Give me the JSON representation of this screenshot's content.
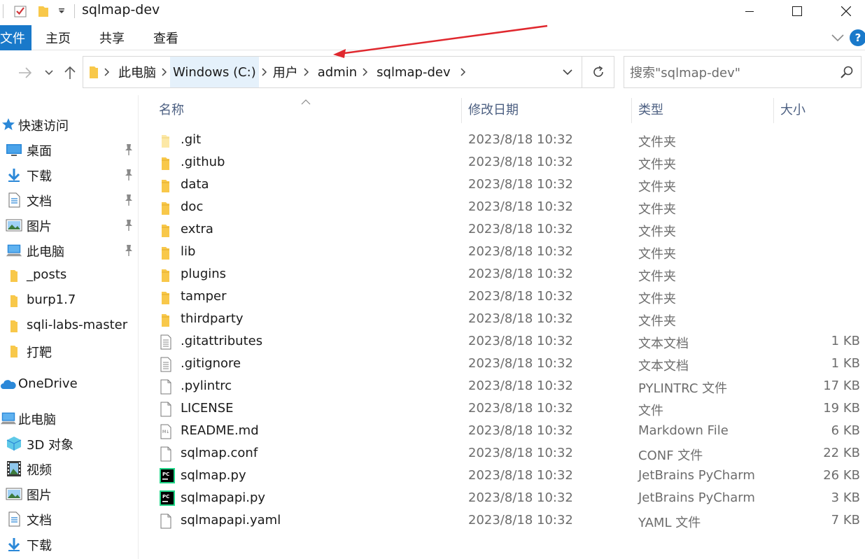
{
  "window": {
    "title": "sqlmap-dev"
  },
  "ribbon": {
    "tabs": [
      "文件",
      "主页",
      "共享",
      "查看"
    ]
  },
  "address": {
    "crumbs": [
      "此电脑",
      "Windows (C:)",
      "用户",
      "admin",
      "sqlmap-dev"
    ]
  },
  "search": {
    "placeholder": "搜索\"sqlmap-dev\""
  },
  "sidebar": {
    "quick_access": "快速访问",
    "items": [
      {
        "label": "桌面",
        "icon": "desktop-icon",
        "pinned": true
      },
      {
        "label": "下载",
        "icon": "download-icon",
        "pinned": true
      },
      {
        "label": "文档",
        "icon": "document-icon",
        "pinned": true
      },
      {
        "label": "图片",
        "icon": "picture-icon",
        "pinned": true
      },
      {
        "label": "此电脑",
        "icon": "computer-icon",
        "pinned": true
      },
      {
        "label": "_posts",
        "icon": "folder-icon",
        "pinned": false
      },
      {
        "label": "burp1.7",
        "icon": "folder-icon",
        "pinned": false
      },
      {
        "label": "sqli-labs-master",
        "icon": "folder-icon",
        "pinned": false
      },
      {
        "label": "打靶",
        "icon": "folder-icon",
        "pinned": false
      }
    ],
    "onedrive": "OneDrive",
    "this_pc": "此电脑",
    "pc_items": [
      {
        "label": "3D 对象",
        "icon": "3d-objects-icon"
      },
      {
        "label": "视频",
        "icon": "video-icon"
      },
      {
        "label": "图片",
        "icon": "picture-icon"
      },
      {
        "label": "文档",
        "icon": "document-icon"
      },
      {
        "label": "下载",
        "icon": "download-icon"
      }
    ]
  },
  "columns": {
    "name": "名称",
    "date": "修改日期",
    "type": "类型",
    "size": "大小"
  },
  "files": [
    {
      "name": ".git",
      "date": "2023/8/18 10:32",
      "type": "文件夹",
      "size": "",
      "icon": "folder-light-icon"
    },
    {
      "name": ".github",
      "date": "2023/8/18 10:32",
      "type": "文件夹",
      "size": "",
      "icon": "folder-icon"
    },
    {
      "name": "data",
      "date": "2023/8/18 10:32",
      "type": "文件夹",
      "size": "",
      "icon": "folder-icon"
    },
    {
      "name": "doc",
      "date": "2023/8/18 10:32",
      "type": "文件夹",
      "size": "",
      "icon": "folder-icon"
    },
    {
      "name": "extra",
      "date": "2023/8/18 10:32",
      "type": "文件夹",
      "size": "",
      "icon": "folder-icon"
    },
    {
      "name": "lib",
      "date": "2023/8/18 10:32",
      "type": "文件夹",
      "size": "",
      "icon": "folder-icon"
    },
    {
      "name": "plugins",
      "date": "2023/8/18 10:32",
      "type": "文件夹",
      "size": "",
      "icon": "folder-icon"
    },
    {
      "name": "tamper",
      "date": "2023/8/18 10:32",
      "type": "文件夹",
      "size": "",
      "icon": "folder-icon"
    },
    {
      "name": "thirdparty",
      "date": "2023/8/18 10:32",
      "type": "文件夹",
      "size": "",
      "icon": "folder-icon"
    },
    {
      "name": ".gitattributes",
      "date": "2023/8/18 10:32",
      "type": "文本文档",
      "size": "1 KB",
      "icon": "text-file-icon"
    },
    {
      "name": ".gitignore",
      "date": "2023/8/18 10:32",
      "type": "文本文档",
      "size": "1 KB",
      "icon": "text-file-icon"
    },
    {
      "name": ".pylintrc",
      "date": "2023/8/18 10:32",
      "type": "PYLINTRC 文件",
      "size": "17 KB",
      "icon": "blank-file-icon"
    },
    {
      "name": "LICENSE",
      "date": "2023/8/18 10:32",
      "type": "文件",
      "size": "19 KB",
      "icon": "blank-file-icon"
    },
    {
      "name": "README.md",
      "date": "2023/8/18 10:32",
      "type": "Markdown File",
      "size": "6 KB",
      "icon": "markdown-file-icon"
    },
    {
      "name": "sqlmap.conf",
      "date": "2023/8/18 10:32",
      "type": "CONF 文件",
      "size": "22 KB",
      "icon": "blank-file-icon"
    },
    {
      "name": "sqlmap.py",
      "date": "2023/8/18 10:32",
      "type": "JetBrains PyCharm",
      "size": "26 KB",
      "icon": "pycharm-icon"
    },
    {
      "name": "sqlmapapi.py",
      "date": "2023/8/18 10:32",
      "type": "JetBrains PyCharm",
      "size": "3 KB",
      "icon": "pycharm-icon"
    },
    {
      "name": "sqlmapapi.yaml",
      "date": "2023/8/18 10:32",
      "type": "YAML 文件",
      "size": "7 KB",
      "icon": "blank-file-icon"
    }
  ],
  "colors": {
    "accent": "#1979ca",
    "folder": "#f8c84a",
    "annotation_arrow": "#e0282e"
  }
}
